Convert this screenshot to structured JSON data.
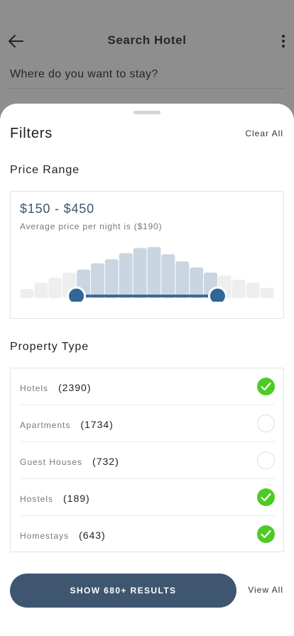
{
  "background": {
    "title": "Search Hotel",
    "question": "Where do you want to stay?"
  },
  "filters": {
    "title": "Filters",
    "clear_all": "Clear All"
  },
  "price": {
    "section_label": "Price Range",
    "range_text": "$150 - $450",
    "average_text": "Average price per night is ($190)",
    "histogram_heights": [
      0.18,
      0.3,
      0.4,
      0.5,
      0.56,
      0.68,
      0.76,
      0.88,
      0.98,
      1.0,
      0.86,
      0.72,
      0.6,
      0.5,
      0.44,
      0.36,
      0.3,
      0.2
    ],
    "selected_from_bar": 4,
    "selected_to_bar": 14,
    "colors": {
      "bar_selected": "#c9d5e1",
      "bar_unselected": "#eeeeee",
      "track": "#3e6a96",
      "handle": "#2f6797"
    }
  },
  "property_type": {
    "section_label": "Property Type",
    "items": [
      {
        "name": "Hotels",
        "count": "(2390)",
        "checked": true
      },
      {
        "name": "Apartments",
        "count": "(1734)",
        "checked": false
      },
      {
        "name": "Guest Houses",
        "count": "(732)",
        "checked": false
      },
      {
        "name": "Hostels",
        "count": "(189)",
        "checked": true
      },
      {
        "name": "Homestays",
        "count": "(643)",
        "checked": true
      }
    ]
  },
  "footer": {
    "show_results": "SHOW 680+ RESULTS",
    "view_all": "View All"
  },
  "colors": {
    "primary": "#3e5670",
    "check_green": "#4ccb24"
  }
}
